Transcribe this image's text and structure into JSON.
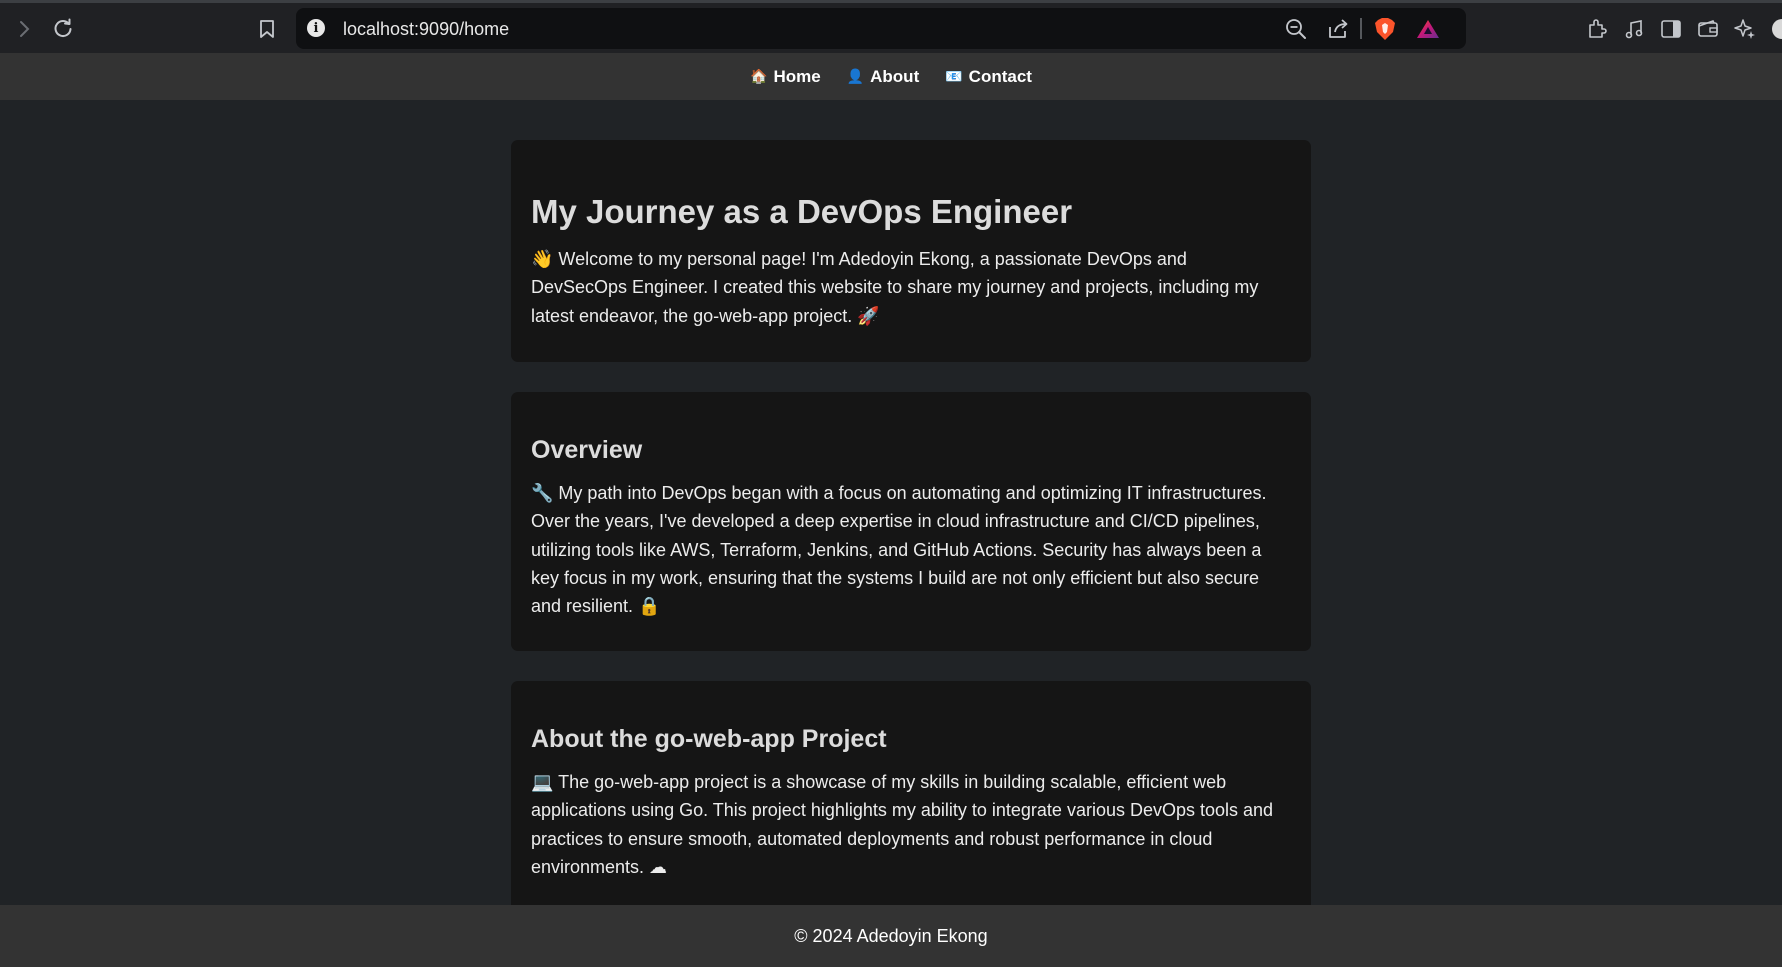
{
  "browser": {
    "url": "localhost:9090/home",
    "icons": [
      "forward-icon",
      "reload-icon",
      "bookmark-icon",
      "site-info-icon",
      "zoom-out-icon",
      "share-icon",
      "brave-shields-icon",
      "brave-rewards-icon",
      "extensions-icon",
      "media-icon",
      "sidebar-icon",
      "wallet-icon",
      "leo-ai-icon"
    ]
  },
  "nav": {
    "home": {
      "emoji": "🏠",
      "label": "Home"
    },
    "about": {
      "emoji": "👤",
      "label": "About"
    },
    "contact": {
      "emoji": "📧",
      "label": "Contact"
    }
  },
  "intro": {
    "title": "My Journey as a DevOps Engineer",
    "text": "👋 Welcome to my personal page! I'm Adedoyin Ekong, a passionate DevOps and DevSecOps Engineer. I created this website to share my journey and projects, including my latest endeavor, the go-web-app project. 🚀"
  },
  "overview": {
    "title": "Overview",
    "text": "🔧 My path into DevOps began with a focus on automating and optimizing IT infrastructures. Over the years, I've developed a deep expertise in cloud infrastructure and CI/CD pipelines, utilizing tools like AWS, Terraform, Jenkins, and GitHub Actions. Security has always been a key focus in my work, ensuring that the systems I build are not only efficient but also secure and resilient. 🔒"
  },
  "project": {
    "title": "About the go-web-app Project",
    "text": "💻 The go-web-app project is a showcase of my skills in building scalable, efficient web applications using Go. This project highlights my ability to integrate various DevOps tools and practices to ensure smooth, automated deployments and robust performance in cloud environments. ☁"
  },
  "footer": {
    "text": "© 2024 Adedoyin Ekong"
  },
  "colors": {
    "page_bg": "#202326",
    "card_bg": "#151515",
    "nav_bg": "#333333",
    "footer_bg": "#333333",
    "brave_orange": "#fb542b"
  }
}
